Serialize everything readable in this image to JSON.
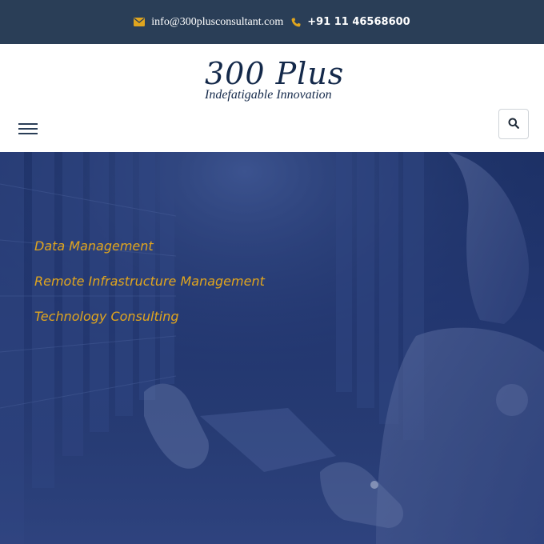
{
  "topbar": {
    "email": "info@300plusconsultant.com",
    "phone": "+91 11 46568600",
    "email_icon": "envelope-icon",
    "phone_icon": "phone-icon",
    "accent_color": "#e0a51e"
  },
  "header": {
    "logo_text": "300 Plus",
    "logo_tagline": "Indefatigable Innovation",
    "menu_icon": "hamburger-menu-icon",
    "search_icon": "search-icon"
  },
  "hero": {
    "links": [
      {
        "label": "Data Management"
      },
      {
        "label": "Remote Infrastructure Management"
      },
      {
        "label": "Technology Consulting"
      }
    ],
    "link_color": "#e0a51e"
  },
  "colors": {
    "topbar_bg": "#2a3e57",
    "brand_navy": "#14294a",
    "hero_overlay": "#1f336b"
  }
}
